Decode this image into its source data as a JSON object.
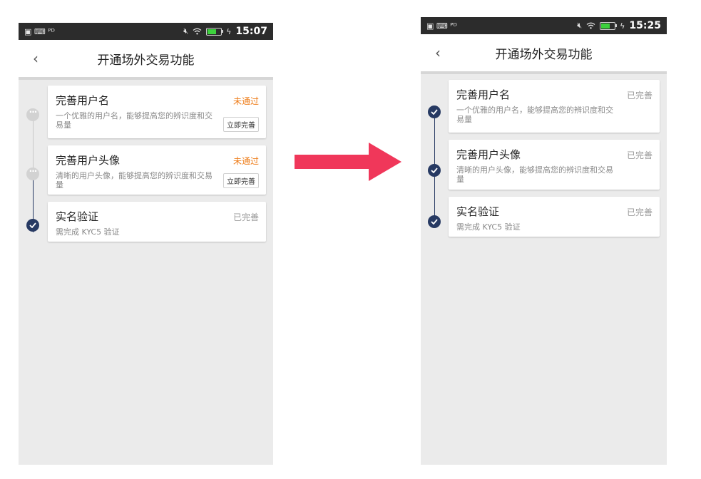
{
  "left_screen": {
    "status_bar": {
      "left_icons": "▣ ⌨ ᴾᴰ",
      "time": "15:07"
    },
    "header": {
      "back": "‹",
      "title": "开通场外交易功能"
    },
    "steps": [
      {
        "title": "完善用户名",
        "desc": "一个优雅的用户名，能够提高您的辨识度和交易量",
        "status": "未通过",
        "action": "立即完善"
      },
      {
        "title": "完善用户头像",
        "desc": "清晰的用户头像，能够提高您的辨识度和交易量",
        "status": "未通过",
        "action": "立即完善"
      },
      {
        "title": "实名验证",
        "desc": "需完成 KYC5 验证",
        "status": "已完善"
      }
    ]
  },
  "right_screen": {
    "status_bar": {
      "left_icons": "▣ ⌨ ᴾᴰ",
      "time": "15:25"
    },
    "header": {
      "back": "‹",
      "title": "开通场外交易功能"
    },
    "steps": [
      {
        "title": "完善用户名",
        "desc": "一个优雅的用户名，能够提高您的辨识度和交易量",
        "status": "已完善"
      },
      {
        "title": "完善用户头像",
        "desc": "清晰的用户头像，能够提高您的辨识度和交易量",
        "status": "已完善"
      },
      {
        "title": "实名验证",
        "desc": "需完成 KYC5 验证",
        "status": "已完善"
      }
    ]
  },
  "colors": {
    "fail": "#ee7d1a",
    "done_node": "#273a63",
    "arrow": "#f0375a"
  },
  "icons": {
    "back": "chevron-left-icon",
    "arrow": "right-arrow-icon"
  }
}
